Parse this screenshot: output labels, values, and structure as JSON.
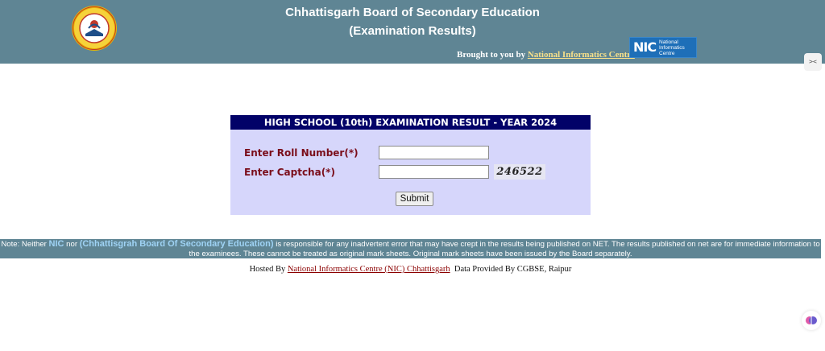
{
  "header": {
    "title": "Chhattisgarh Board of Secondary Education",
    "subtitle": "(Examination Results)",
    "brought_prefix": "Brought to you by",
    "brought_link": "National Informatics Centre",
    "nic_big": "NIC",
    "nic_small1": "National",
    "nic_small2": "Informatics",
    "nic_small3": "Centre"
  },
  "form": {
    "heading": "HIGH SCHOOL (10th) EXAMINATION RESULT - YEAR 2024",
    "roll_label": "Enter Roll Number(*)",
    "roll_value": "",
    "captcha_label": "Enter Captcha(*)",
    "captcha_value": "",
    "captcha_code": "246522",
    "submit_label": "Submit"
  },
  "note": {
    "prefix": "Note: Neither",
    "nic": "NIC",
    "nor": "nor",
    "board": "(Chhattisgrah Board Of Secondary Education)",
    "rest": "is responsible for any inadvertent error that may have crept in the results being published on NET. The results published on net are for immediate information to the examinees. These cannot be treated as original mark sheets. Original mark sheets have been issued by the Board separately."
  },
  "footer": {
    "hosted_prefix": "Hosted By",
    "hosted_link": "National Informatics Centre (NIC) Chhattisgarh",
    "data_provided": "Data Provided By CGBSE, Raipur"
  },
  "colors": {
    "header_bg": "#5f8594",
    "panel_bg": "#d6d6fb",
    "panel_head": "#020268",
    "label": "#7a0d1a"
  },
  "icons": {
    "board_logo": "cgbse-emblem-icon",
    "nic_logo": "nic-logo-icon",
    "side_tab": "code-tab-icon",
    "brain": "brain-icon"
  }
}
